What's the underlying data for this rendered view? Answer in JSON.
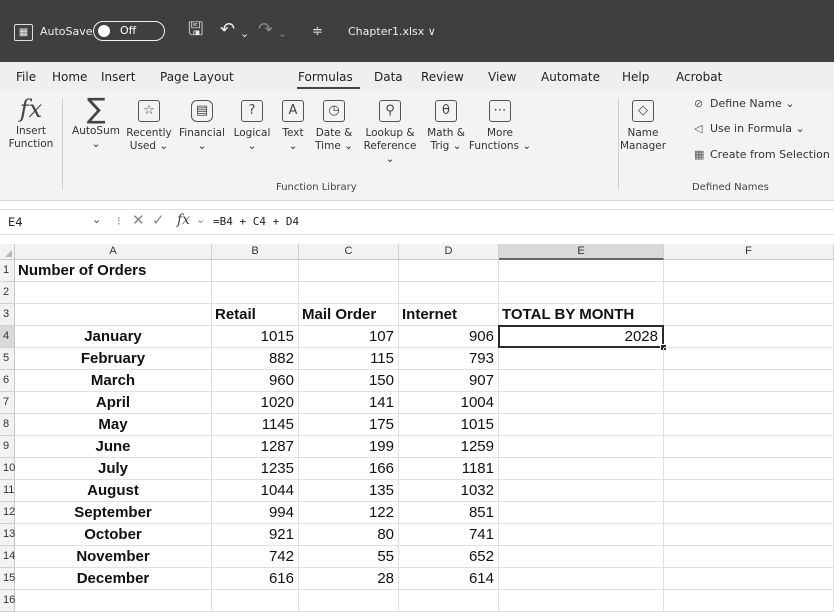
{
  "titlebar": {
    "autosave_label": "AutoSave",
    "autosave_state": "Off",
    "filename": "Chapter1.xlsx ∨"
  },
  "menu": [
    "File",
    "Home",
    "Insert",
    "Page Layout",
    "Formulas",
    "Data",
    "Review",
    "View",
    "Automate",
    "Help",
    "Acrobat"
  ],
  "menu_active": "Formulas",
  "ribbon": {
    "function_library": {
      "insert_function": [
        "Insert",
        "Function"
      ],
      "buttons": [
        {
          "label": [
            "AutoSum",
            "⌄"
          ],
          "icon": "sigma-icon",
          "glyph": "∑"
        },
        {
          "label": [
            "Recently",
            "Used ⌄"
          ],
          "icon": "star-icon",
          "glyph": "☆"
        },
        {
          "label": [
            "Financial",
            "⌄"
          ],
          "icon": "database-icon",
          "glyph": "▤"
        },
        {
          "label": [
            "Logical",
            "⌄"
          ],
          "icon": "question-icon",
          "glyph": "?"
        },
        {
          "label": [
            "Text",
            "⌄"
          ],
          "icon": "text-icon",
          "glyph": "A"
        },
        {
          "label": [
            "Date &",
            "Time ⌄"
          ],
          "icon": "clock-icon",
          "glyph": "◷"
        },
        {
          "label": [
            "Lookup &",
            "Reference ⌄"
          ],
          "icon": "search-icon",
          "glyph": "⚲"
        },
        {
          "label": [
            "Math &",
            "Trig ⌄"
          ],
          "icon": "theta-icon",
          "glyph": "θ"
        },
        {
          "label": [
            "More",
            "Functions ⌄"
          ],
          "icon": "more-icon",
          "glyph": "⋯"
        }
      ],
      "group_label": "Function Library"
    },
    "defined_names": {
      "name_manager": [
        "Name",
        "Manager"
      ],
      "define_name": "Define Name ⌄",
      "use_in_formula": "Use in Formula ⌄",
      "create_from_selection": "Create from Selection",
      "group_label": "Defined Names"
    }
  },
  "formula_bar": {
    "name_box": "E4",
    "formula": "=B4 + C4 + D4"
  },
  "sheet": {
    "columns": [
      "A",
      "B",
      "C",
      "D",
      "E",
      "F"
    ],
    "selected_column": "E",
    "selected_row": 4,
    "rows": [
      {
        "n": "1",
        "A": "Number of Orders",
        "B": "",
        "C": "",
        "D": "",
        "E": ""
      },
      {
        "n": "2",
        "A": "",
        "B": "",
        "C": "",
        "D": "",
        "E": ""
      },
      {
        "n": "3",
        "A": "",
        "B": "Retail",
        "C": "Mail Order",
        "D": "Internet",
        "E": "TOTAL BY MONTH"
      },
      {
        "n": "4",
        "A": "January",
        "B": "1015",
        "C": "107",
        "D": "906",
        "E": "2028"
      },
      {
        "n": "5",
        "A": "February",
        "B": "882",
        "C": "115",
        "D": "793",
        "E": ""
      },
      {
        "n": "6",
        "A": "March",
        "B": "960",
        "C": "150",
        "D": "907",
        "E": ""
      },
      {
        "n": "7",
        "A": "April",
        "B": "1020",
        "C": "141",
        "D": "1004",
        "E": ""
      },
      {
        "n": "8",
        "A": "May",
        "B": "1145",
        "C": "175",
        "D": "1015",
        "E": ""
      },
      {
        "n": "9",
        "A": "June",
        "B": "1287",
        "C": "199",
        "D": "1259",
        "E": ""
      },
      {
        "n": "10",
        "A": "July",
        "B": "1235",
        "C": "166",
        "D": "1181",
        "E": ""
      },
      {
        "n": "11",
        "A": "August",
        "B": "1044",
        "C": "135",
        "D": "1032",
        "E": ""
      },
      {
        "n": "12",
        "A": "September",
        "B": "994",
        "C": "122",
        "D": "851",
        "E": ""
      },
      {
        "n": "13",
        "A": "October",
        "B": "921",
        "C": "80",
        "D": "741",
        "E": ""
      },
      {
        "n": "14",
        "A": "November",
        "B": "742",
        "C": "55",
        "D": "652",
        "E": ""
      },
      {
        "n": "15",
        "A": "December",
        "B": "616",
        "C": "28",
        "D": "614",
        "E": ""
      },
      {
        "n": "16",
        "A": "",
        "B": "",
        "C": "",
        "D": "",
        "E": ""
      }
    ]
  }
}
